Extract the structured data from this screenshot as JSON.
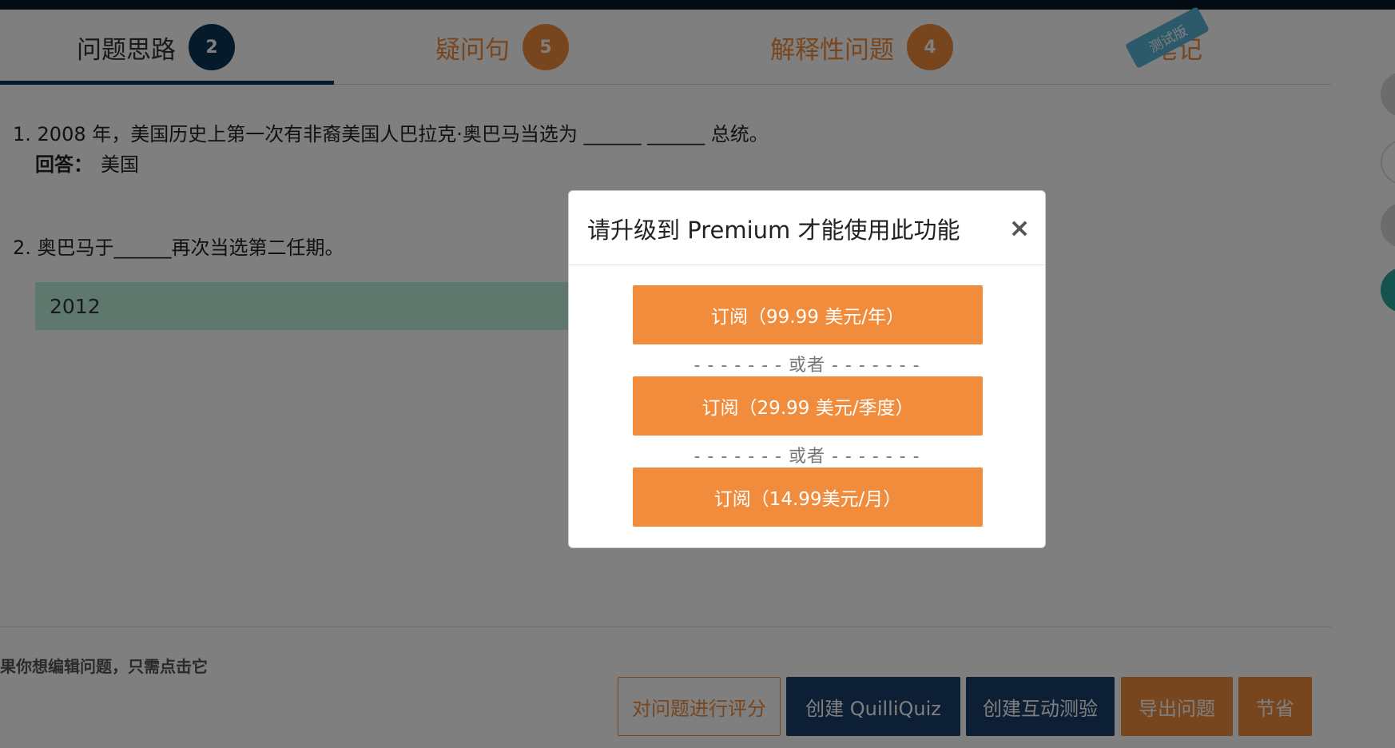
{
  "tabs": [
    {
      "label": "问题思路",
      "count": "2"
    },
    {
      "label": "疑问句",
      "count": "5"
    },
    {
      "label": "解释性问题",
      "count": "4"
    },
    {
      "label": "笔记"
    }
  ],
  "beta_badge": "测试版",
  "questions": [
    {
      "text": "1. 2008 年，美国历史上第一次有非裔美国人巴拉克·奥巴马当选为 ______ ______ 总统。",
      "answer_label": "回答：",
      "answer": "美国"
    },
    {
      "text": "2. 奥巴马于______再次当选第二任期。",
      "answer": "2012"
    }
  ],
  "footer": {
    "hint": "果你想编辑问题，只需点击它",
    "buttons": {
      "rate": "对问题进行评分",
      "quilliquiz": "创建 QuilliQuiz",
      "interactive": "创建互动测验",
      "export": "导出问题",
      "save": "节省"
    }
  },
  "modal": {
    "title": "请升级到 Premium 才能使用此功能",
    "close": "×",
    "options": [
      "订阅（99.99 美元/年）",
      "订阅（29.99 美元/季度）",
      "订阅（14.99美元/月）"
    ],
    "separator": "- - - - - - - 或者 - - - - - - -"
  }
}
